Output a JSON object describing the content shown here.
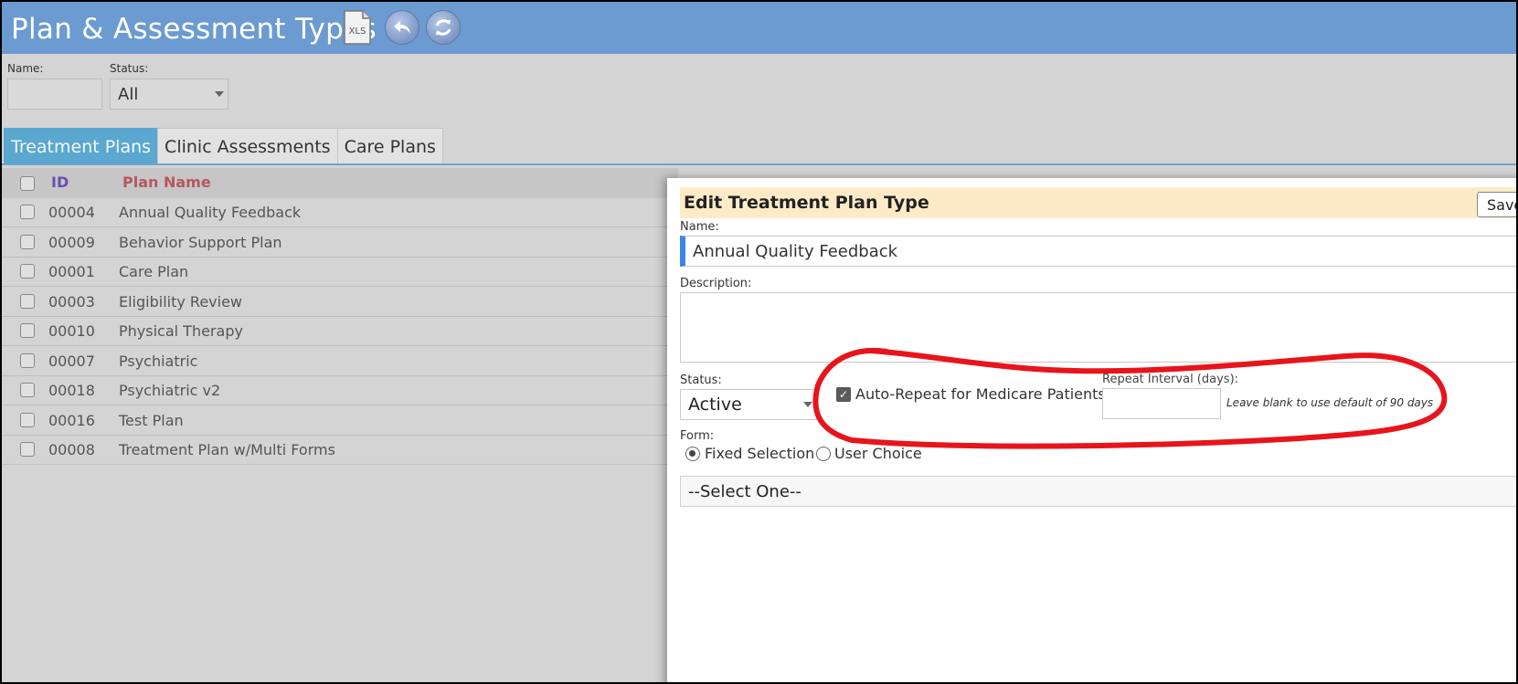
{
  "header": {
    "title": "Plan & Assessment Types",
    "xls_label": "XLS",
    "icons": [
      "xls-export-icon",
      "back-arrow-icon",
      "refresh-icon"
    ]
  },
  "filters": {
    "name_label": "Name:",
    "name_value": "",
    "status_label": "Status:",
    "status_value": "All"
  },
  "tabs": [
    {
      "label": "Treatment Plans",
      "active": true
    },
    {
      "label": "Clinic Assessments",
      "active": false
    },
    {
      "label": "Care Plans",
      "active": false
    }
  ],
  "table": {
    "columns": {
      "id": "ID",
      "name": "Plan Name"
    },
    "rows": [
      {
        "id": "00004",
        "name": "Annual Quality Feedback"
      },
      {
        "id": "00009",
        "name": "Behavior Support Plan"
      },
      {
        "id": "00001",
        "name": "Care Plan"
      },
      {
        "id": "00003",
        "name": "Eligibility Review"
      },
      {
        "id": "00010",
        "name": "Physical Therapy"
      },
      {
        "id": "00007",
        "name": "Psychiatric"
      },
      {
        "id": "00018",
        "name": "Psychiatric v2"
      },
      {
        "id": "00016",
        "name": "Test Plan"
      },
      {
        "id": "00008",
        "name": "Treatment Plan w/Multi Forms"
      }
    ]
  },
  "edit_panel": {
    "title": "Edit Treatment Plan Type",
    "save_label": "Save",
    "name_label": "Name:",
    "name_value": "Annual Quality Feedback",
    "description_label": "Description:",
    "description_value": "",
    "status_label": "Status:",
    "status_value": "Active",
    "auto_repeat_label": "Auto-Repeat for Medicare Patients",
    "auto_repeat_checked": true,
    "repeat_interval_label": "Repeat Interval (days):",
    "repeat_interval_value": "",
    "repeat_hint": "Leave blank to use default of 90 days",
    "form_label": "Form:",
    "form_mode_options": [
      {
        "label": "Fixed Selection",
        "selected": true
      },
      {
        "label": "User Choice",
        "selected": false
      }
    ],
    "form_select_value": "--Select One--"
  },
  "colors": {
    "header_bg": "#6b9bd1",
    "active_tab": "#5aa7cf",
    "id_header": "#6a4fb0",
    "name_header": "#b5575f",
    "panel_header_bg": "#fdebc8",
    "annotation": "#e8141c"
  }
}
